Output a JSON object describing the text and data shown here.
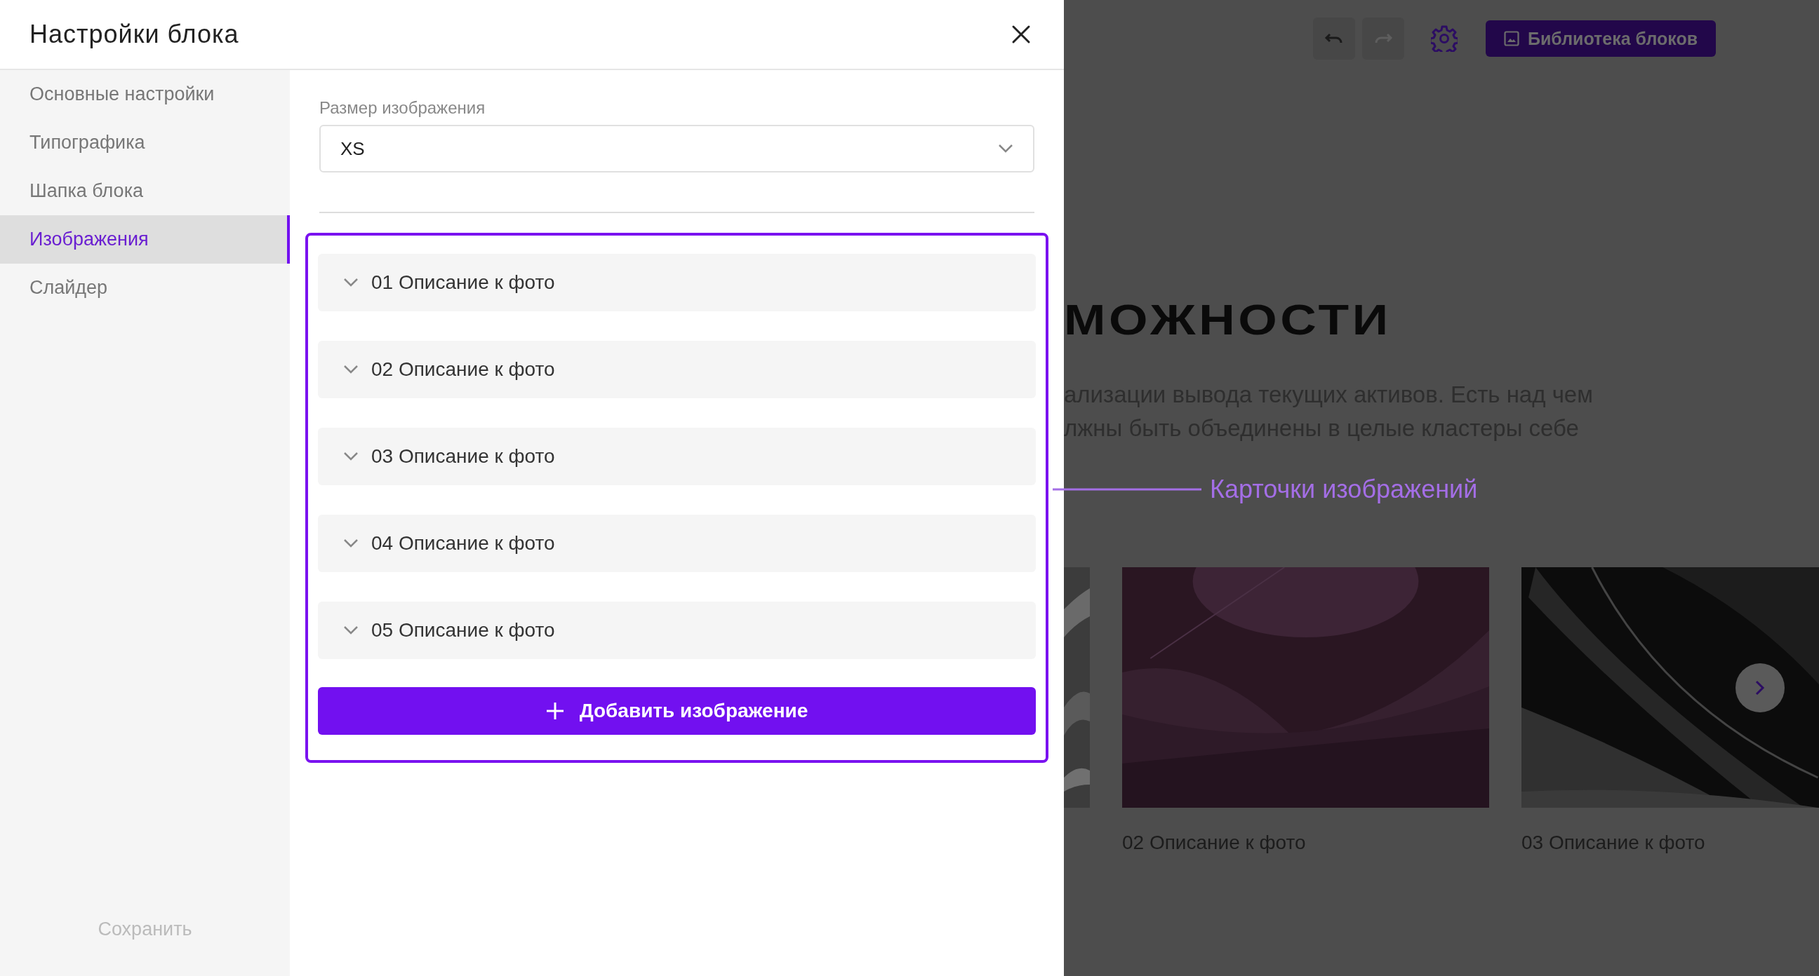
{
  "dialog": {
    "title": "Настройки блока"
  },
  "sidebar": {
    "items": [
      {
        "label": "Основные настройки",
        "selected": false
      },
      {
        "label": "Типографика",
        "selected": false
      },
      {
        "label": "Шапка блока",
        "selected": false
      },
      {
        "label": "Изображения",
        "selected": true
      },
      {
        "label": "Слайдер",
        "selected": false
      }
    ],
    "save_button": "Сохранить"
  },
  "image_size": {
    "label": "Размер изображения",
    "value": "XS"
  },
  "image_cards": [
    {
      "title": "01 Описание к фото"
    },
    {
      "title": "02 Описание к фото"
    },
    {
      "title": "03 Описание к фото"
    },
    {
      "title": "04 Описание к фото"
    },
    {
      "title": "05 Описание к фото"
    }
  ],
  "add_button": "Добавить изображение",
  "annotation": "Карточки изображений",
  "background_page": {
    "toolbar": {
      "redo_disabled": true,
      "library_button": "Библиотека блоков"
    },
    "heading": "МОЖНОСТИ",
    "paragraph": [
      "ализации вывода текущих активов. Есть над чем",
      "лжны быть объединены в целые кластеры себе"
    ],
    "slides": [
      {
        "caption": "02 Описание к фото"
      },
      {
        "caption": "03 Описание к фото"
      }
    ]
  }
}
